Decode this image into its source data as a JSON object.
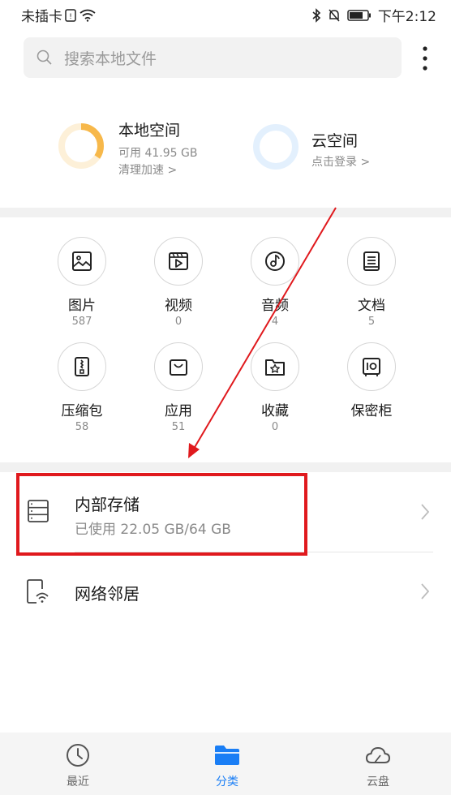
{
  "status_bar": {
    "carrier": "未插卡",
    "time": "下午2:12"
  },
  "search": {
    "placeholder": "搜索本地文件"
  },
  "storage_summary": {
    "local": {
      "title": "本地空间",
      "available": "可用 41.95 GB",
      "action": "清理加速 >"
    },
    "cloud": {
      "title": "云空间",
      "action": "点击登录 >"
    }
  },
  "categories": [
    {
      "name": "图片",
      "count": "587",
      "icon": "image-icon"
    },
    {
      "name": "视频",
      "count": "0",
      "icon": "video-icon"
    },
    {
      "name": "音频",
      "count": "4",
      "icon": "music-icon"
    },
    {
      "name": "文档",
      "count": "5",
      "icon": "document-icon"
    },
    {
      "name": "压缩包",
      "count": "58",
      "icon": "archive-icon"
    },
    {
      "name": "应用",
      "count": "51",
      "icon": "app-bag-icon"
    },
    {
      "name": "收藏",
      "count": "0",
      "icon": "favorite-folder-icon"
    },
    {
      "name": "保密柜",
      "count": "",
      "icon": "safe-icon"
    }
  ],
  "locations": [
    {
      "title": "内部存储",
      "subtitle": "已使用 22.05 GB/64 GB",
      "icon": "storage-icon"
    },
    {
      "title": "网络邻居",
      "subtitle": "",
      "icon": "network-neighborhood-icon"
    }
  ],
  "bottom_nav": [
    {
      "label": "最近",
      "icon": "clock-icon",
      "active": false
    },
    {
      "label": "分类",
      "icon": "folder-icon",
      "active": true
    },
    {
      "label": "云盘",
      "icon": "cloud-icon",
      "active": false
    }
  ],
  "colors": {
    "accent": "#1a7ef5",
    "local_ring": "#f7b84a",
    "cloud_ring": "#e3f0fd",
    "highlight_box": "#e0191d",
    "arrow": "#e0191d"
  }
}
